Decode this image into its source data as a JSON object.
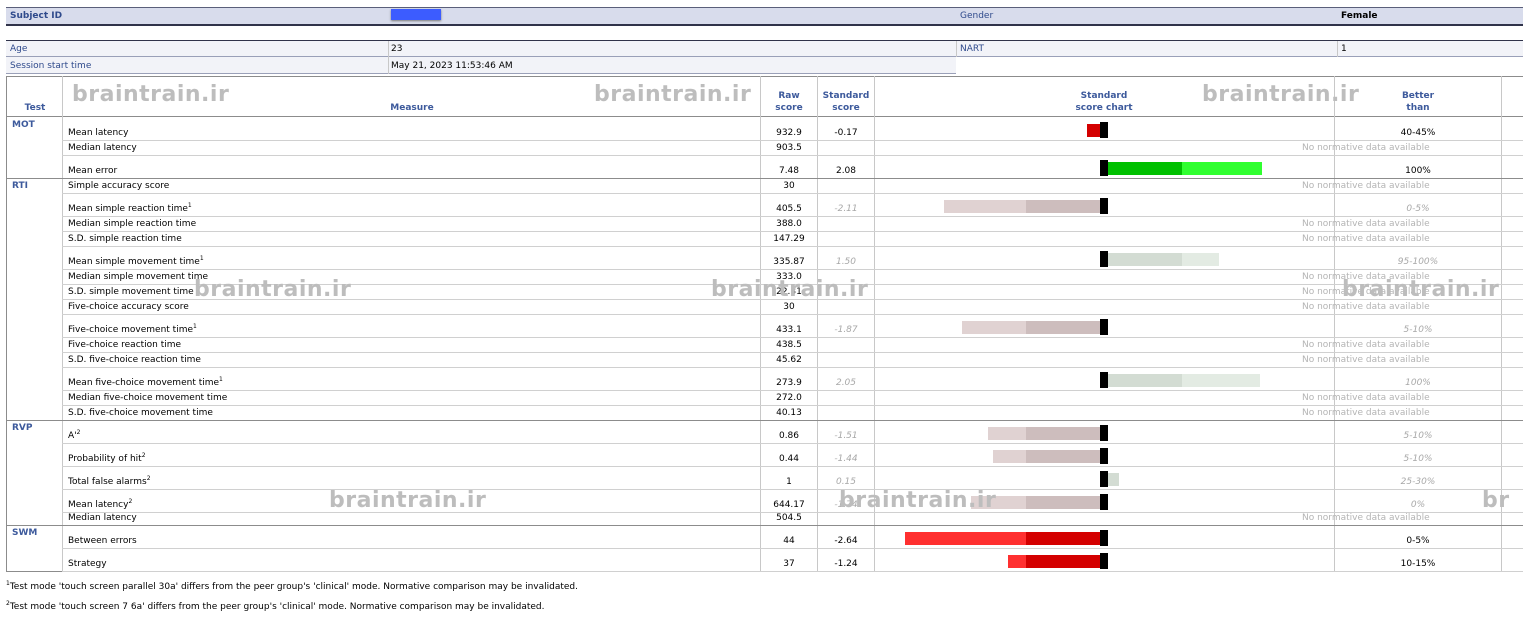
{
  "header": {
    "subject_id_label": "Subject ID",
    "gender_label": "Gender",
    "gender_value": "Female",
    "age_label": "Age",
    "age_value": "23",
    "nart_label": "NART",
    "nart_value": "1",
    "session_label": "Session start time",
    "session_value": "May 21, 2023 11:53:46 AM"
  },
  "columns": {
    "test": "Test",
    "measure": "Measure",
    "raw_1": "Raw",
    "raw_2": "score",
    "std_1": "Standard",
    "std_2": "score",
    "chart_1": "Standard",
    "chart_2": "score chart",
    "better_1": "Better",
    "better_2": "than"
  },
  "watermark": "braintrain.ir",
  "watermark_partial": "br",
  "tests": [
    "MOT",
    "RTI",
    "RVP",
    "SWM"
  ],
  "rows": [
    {
      "measure": "Mean latency",
      "sup": "",
      "raw": "932.9",
      "std": "-0.17",
      "better": "40-45%",
      "muted": false,
      "score": -0.17
    },
    {
      "measure": "Median latency",
      "sup": "",
      "raw": "903.5",
      "std": "",
      "better": "No normative data available",
      "muted": true,
      "score": null
    },
    {
      "measure": "Mean error",
      "sup": "",
      "raw": "7.48",
      "std": "2.08",
      "better": "100%",
      "muted": false,
      "score": 2.08
    },
    {
      "measure": "Simple accuracy score",
      "sup": "",
      "raw": "30",
      "std": "",
      "better": "No normative data available",
      "muted": true,
      "score": null
    },
    {
      "measure": "Mean simple reaction time",
      "sup": "1",
      "raw": "405.5",
      "std": "-2.11",
      "better": "0-5%",
      "muted": true,
      "score": -2.11
    },
    {
      "measure": "Median simple reaction time",
      "sup": "",
      "raw": "388.0",
      "std": "",
      "better": "No normative data available",
      "muted": true,
      "score": null
    },
    {
      "measure": "S.D. simple reaction time",
      "sup": "",
      "raw": "147.29",
      "std": "",
      "better": "No normative data available",
      "muted": true,
      "score": null
    },
    {
      "measure": "Mean simple movement time",
      "sup": "1",
      "raw": "335.87",
      "std": "1.50",
      "better": "95-100%",
      "muted": true,
      "score": 1.5
    },
    {
      "measure": "Median simple movement time",
      "sup": "",
      "raw": "333.0",
      "std": "",
      "better": "No normative data available",
      "muted": true,
      "score": null
    },
    {
      "measure": "S.D. simple movement time",
      "sup": "",
      "raw": "22.31",
      "std": "",
      "better": "No normative data available",
      "muted": true,
      "score": null
    },
    {
      "measure": "Five-choice accuracy score",
      "sup": "",
      "raw": "30",
      "std": "",
      "better": "No normative data available",
      "muted": true,
      "score": null
    },
    {
      "measure": "Five-choice movement time",
      "sup": "1",
      "raw": "433.1",
      "std": "-1.87",
      "better": "5-10%",
      "muted": true,
      "score": -1.87
    },
    {
      "measure": "Five-choice reaction time",
      "sup": "",
      "raw": "438.5",
      "std": "",
      "better": "No normative data available",
      "muted": true,
      "score": null
    },
    {
      "measure": "S.D. five-choice reaction time",
      "sup": "",
      "raw": "45.62",
      "std": "",
      "better": "No normative data available",
      "muted": true,
      "score": null
    },
    {
      "measure": "Mean five-choice movement time",
      "sup": "1",
      "raw": "273.9",
      "std": "2.05",
      "better": "100%",
      "muted": true,
      "score": 2.05
    },
    {
      "measure": "Median five-choice movement time",
      "sup": "",
      "raw": "272.0",
      "std": "",
      "better": "No normative data available",
      "muted": true,
      "score": null
    },
    {
      "measure": "S.D. five-choice movement time",
      "sup": "",
      "raw": "40.13",
      "std": "",
      "better": "No normative data available",
      "muted": true,
      "score": null
    },
    {
      "measure": "A'",
      "sup": "2",
      "raw": "0.86",
      "std": "-1.51",
      "better": "5-10%",
      "muted": true,
      "score": -1.51
    },
    {
      "measure": "Probability of hit",
      "sup": "2",
      "raw": "0.44",
      "std": "-1.44",
      "better": "5-10%",
      "muted": true,
      "score": -1.44
    },
    {
      "measure": "Total false alarms",
      "sup": "2",
      "raw": "1",
      "std": "0.15",
      "better": "25-30%",
      "muted": true,
      "score": 0.15
    },
    {
      "measure": "Mean latency",
      "sup": "2",
      "raw": "644.17",
      "std": "-1.74",
      "better": "0%",
      "muted": true,
      "score": -1.74
    },
    {
      "measure": "Median latency",
      "sup": "",
      "raw": "504.5",
      "std": "",
      "better": "No normative data available",
      "muted": true,
      "score": null
    },
    {
      "measure": "Between errors",
      "sup": "",
      "raw": "44",
      "std": "-2.64",
      "better": "0-5%",
      "muted": false,
      "score": -2.64
    },
    {
      "measure": "Strategy",
      "sup": "",
      "raw": "37",
      "std": "-1.24",
      "better": "10-15%",
      "muted": false,
      "score": -1.24
    }
  ],
  "colors": {
    "neg": "#d40000",
    "neg_light": "#ff3030",
    "pos": "#00c000",
    "pos_light": "#30ff30",
    "neg_muted": "#cdbdbd",
    "neg_muted_light": "#e0d2d2",
    "pos_muted": "#d3dcd3",
    "pos_muted_light": "#e3ebe3"
  },
  "footnotes": [
    {
      "mark": "1",
      "text": "Test mode 'touch screen parallel 30a' differs from the peer group's 'clinical' mode. Normative comparison may be invalidated."
    },
    {
      "mark": "2",
      "text": "Test mode 'touch screen 7 6a' differs from the peer group's 'clinical' mode. Normative comparison may be invalidated."
    }
  ]
}
